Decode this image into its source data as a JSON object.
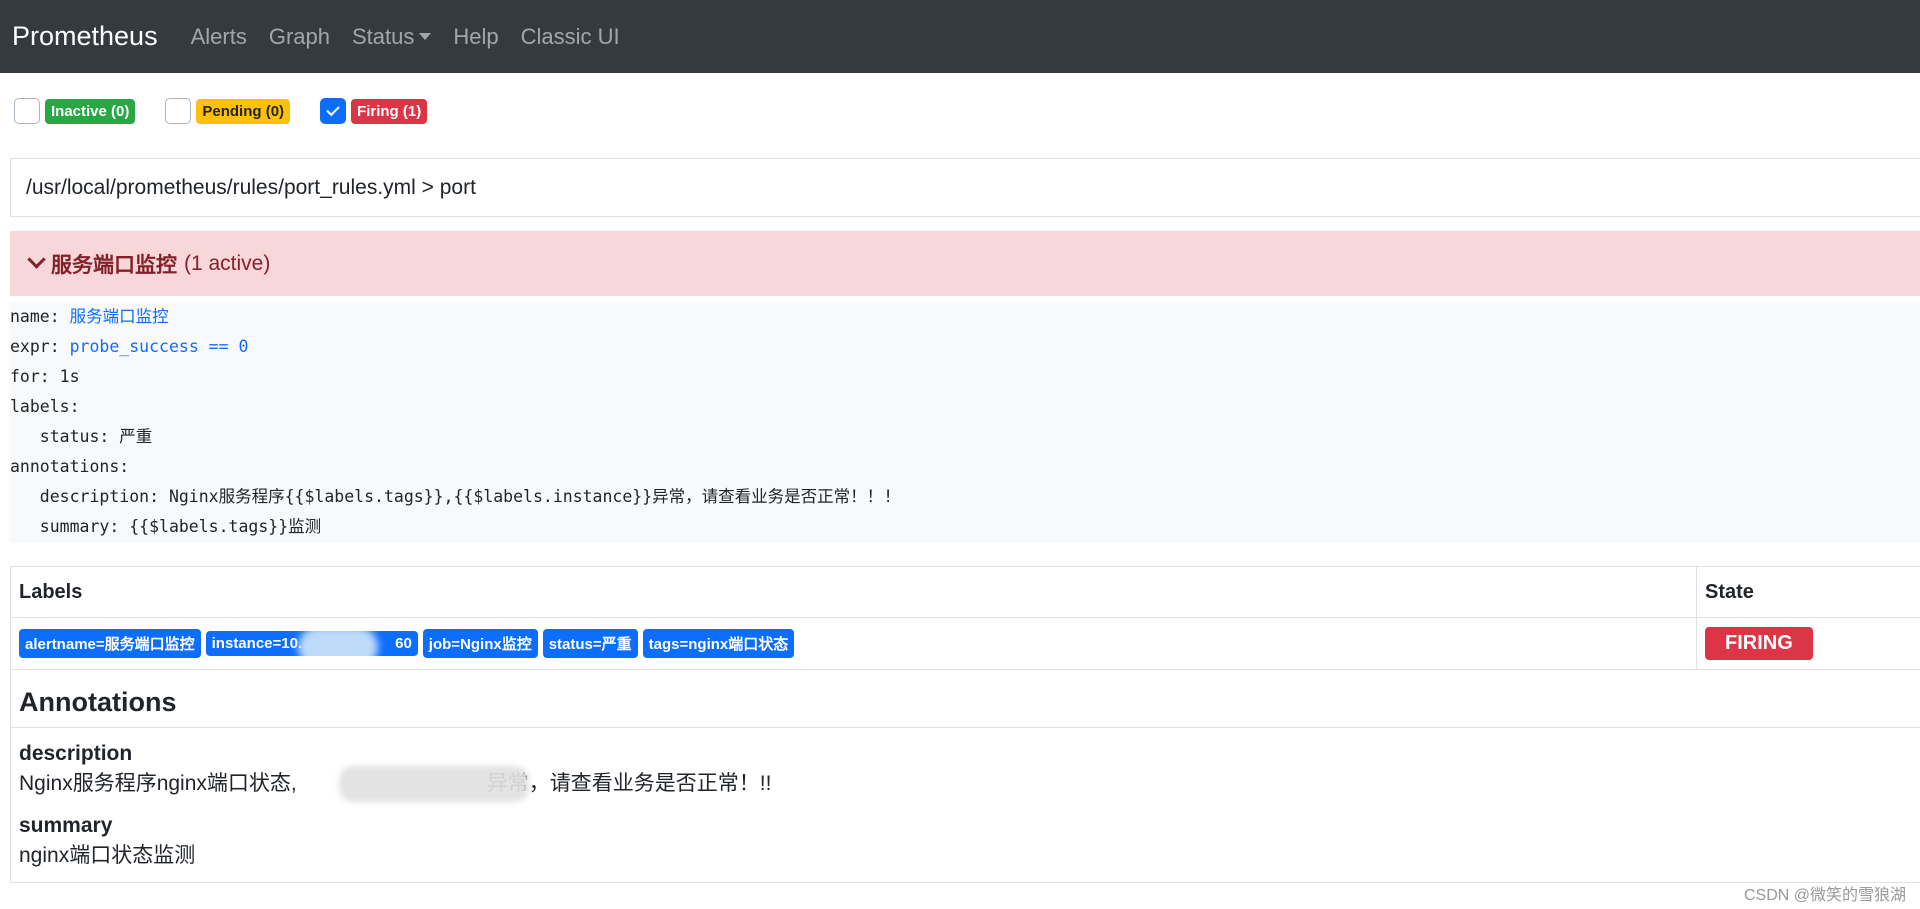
{
  "navbar": {
    "brand": "Prometheus",
    "links": [
      "Alerts",
      "Graph",
      "Status",
      "Help",
      "Classic UI"
    ]
  },
  "filters": {
    "inactive": {
      "label": "Inactive (0)",
      "checked": false
    },
    "pending": {
      "label": "Pending (0)",
      "checked": false
    },
    "firing": {
      "label": "Firing (1)",
      "checked": true
    }
  },
  "rule_file": "/usr/local/prometheus/rules/port_rules.yml > port",
  "group": {
    "name": "服务端口监控",
    "count": "(1 active)"
  },
  "rule": {
    "name_key": "name:",
    "name_val": "服务端口监控",
    "expr_key": "expr:",
    "expr_val": "probe_success == 0",
    "for_line": "for: 1s",
    "labels_line": "labels:",
    "status_line": "   status: 严重",
    "annotations_line": "annotations:",
    "description_line": "   description: Nginx服务程序{{$labels.tags}},{{$labels.instance}}异常，请查看业务是否正常！！!",
    "summary_line": "   summary: {{$labels.tags}}监测"
  },
  "table": {
    "col_labels": "Labels",
    "col_state": "State",
    "labels": [
      "alertname=服务端口监控",
      "instance=10.",
      "60",
      "job=Nginx监控",
      "status=严重",
      "tags=nginx端口状态"
    ],
    "state": "FIRING"
  },
  "annotations": {
    "title": "Annotations",
    "description_key": "description",
    "description_prefix": "Nginx服务程序nginx端口状态,",
    "description_suffix": "异常，请查看业务是否正常！!!",
    "summary_key": "summary",
    "summary_val": "nginx端口状态监测"
  },
  "watermark": "CSDN @微笑的雪狼湖",
  "colors": {
    "navbar": "#343a40",
    "inactive": "#28a745",
    "pending": "#ffc107",
    "firing": "#dc3545",
    "label_badge": "#0d6efd",
    "group_header": "#f8d7da"
  }
}
